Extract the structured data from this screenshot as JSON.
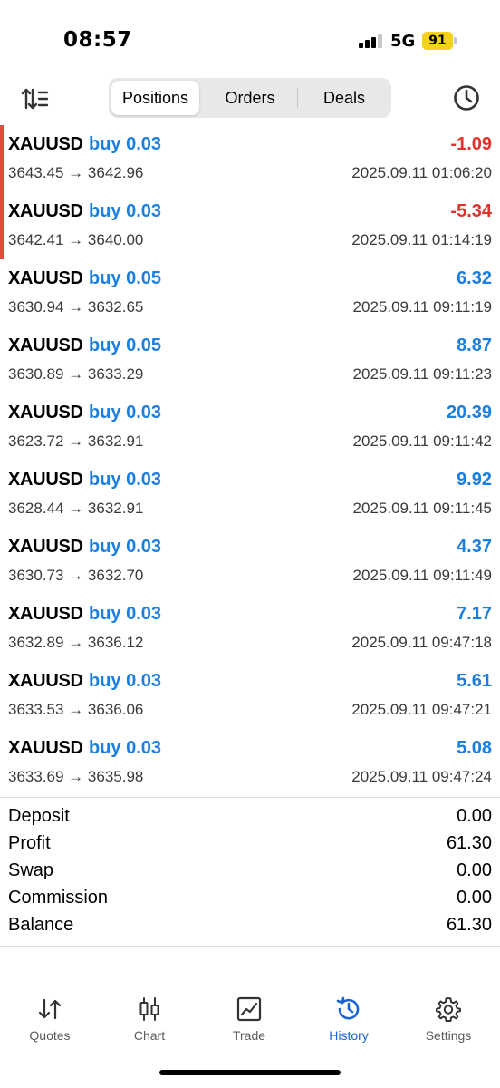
{
  "status_bar": {
    "time": "08:57",
    "network": "5G",
    "battery": "91"
  },
  "toolbar": {
    "segments": [
      "Positions",
      "Orders",
      "Deals"
    ],
    "active_segment": "Positions"
  },
  "positions": [
    {
      "symbol": "XAUUSD",
      "side": "buy 0.03",
      "open": "3643.45",
      "close": "3642.96",
      "profit": "-1.09",
      "time": "2025.09.11 01:06:20",
      "loss": true
    },
    {
      "symbol": "XAUUSD",
      "side": "buy 0.03",
      "open": "3642.41",
      "close": "3640.00",
      "profit": "-5.34",
      "time": "2025.09.11 01:14:19",
      "loss": true
    },
    {
      "symbol": "XAUUSD",
      "side": "buy 0.05",
      "open": "3630.94",
      "close": "3632.65",
      "profit": "6.32",
      "time": "2025.09.11 09:11:19",
      "loss": false
    },
    {
      "symbol": "XAUUSD",
      "side": "buy 0.05",
      "open": "3630.89",
      "close": "3633.29",
      "profit": "8.87",
      "time": "2025.09.11 09:11:23",
      "loss": false
    },
    {
      "symbol": "XAUUSD",
      "side": "buy 0.03",
      "open": "3623.72",
      "close": "3632.91",
      "profit": "20.39",
      "time": "2025.09.11 09:11:42",
      "loss": false
    },
    {
      "symbol": "XAUUSD",
      "side": "buy 0.03",
      "open": "3628.44",
      "close": "3632.91",
      "profit": "9.92",
      "time": "2025.09.11 09:11:45",
      "loss": false
    },
    {
      "symbol": "XAUUSD",
      "side": "buy 0.03",
      "open": "3630.73",
      "close": "3632.70",
      "profit": "4.37",
      "time": "2025.09.11 09:11:49",
      "loss": false
    },
    {
      "symbol": "XAUUSD",
      "side": "buy 0.03",
      "open": "3632.89",
      "close": "3636.12",
      "profit": "7.17",
      "time": "2025.09.11 09:47:18",
      "loss": false
    },
    {
      "symbol": "XAUUSD",
      "side": "buy 0.03",
      "open": "3633.53",
      "close": "3636.06",
      "profit": "5.61",
      "time": "2025.09.11 09:47:21",
      "loss": false
    },
    {
      "symbol": "XAUUSD",
      "side": "buy 0.03",
      "open": "3633.69",
      "close": "3635.98",
      "profit": "5.08",
      "time": "2025.09.11 09:47:24",
      "loss": false
    }
  ],
  "summary": [
    {
      "label": "Deposit",
      "value": "0.00"
    },
    {
      "label": "Profit",
      "value": "61.30"
    },
    {
      "label": "Swap",
      "value": "0.00"
    },
    {
      "label": "Commission",
      "value": "0.00"
    },
    {
      "label": "Balance",
      "value": "61.30"
    }
  ],
  "tabs": [
    {
      "label": "Quotes",
      "icon": "quotes-icon"
    },
    {
      "label": "Chart",
      "icon": "chart-candles-icon"
    },
    {
      "label": "Trade",
      "icon": "trade-icon"
    },
    {
      "label": "History",
      "icon": "history-icon",
      "active": true
    },
    {
      "label": "Settings",
      "icon": "gear-icon"
    }
  ],
  "colors": {
    "loss": "#e1322b",
    "profit": "#1a7fe0",
    "accent": "#1a64d6",
    "loss_marker": "#e14b3b"
  }
}
